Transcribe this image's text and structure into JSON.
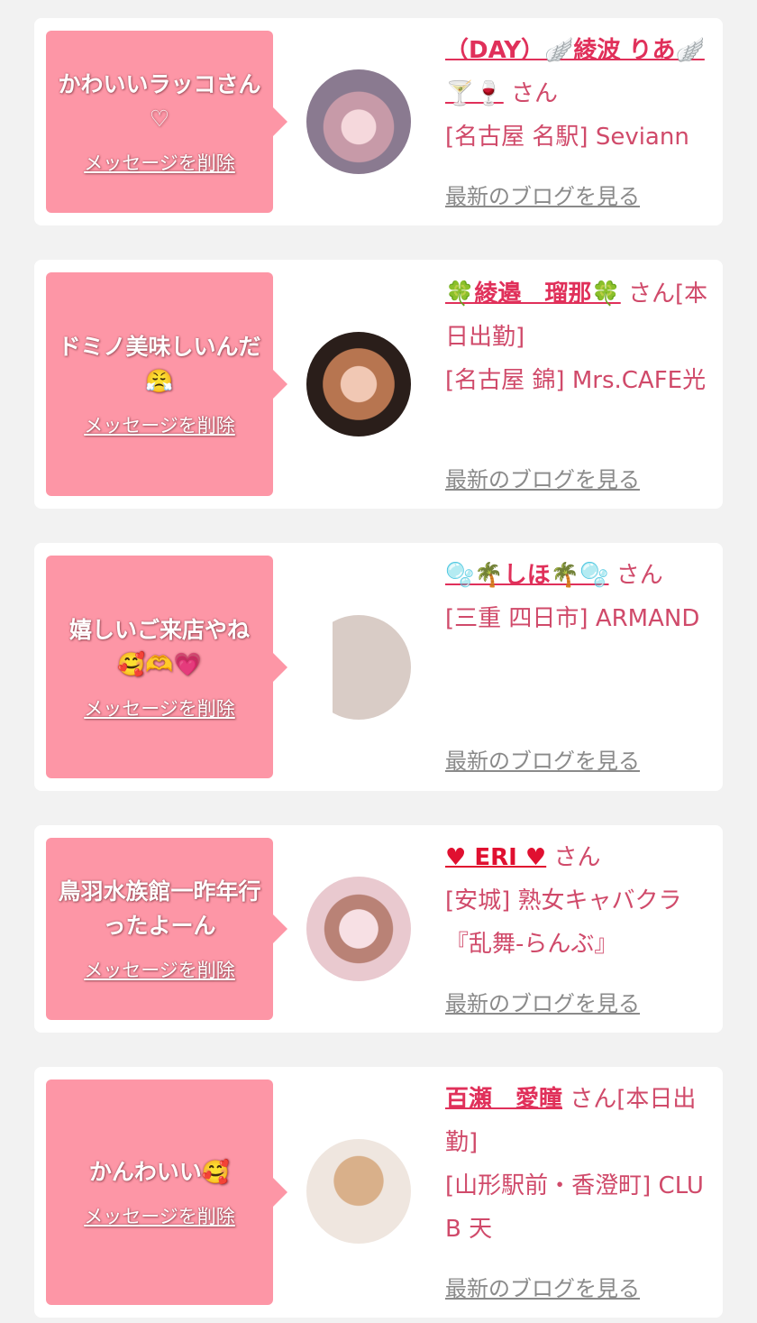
{
  "cards": [
    {
      "message": "かわいいラッコさん♡",
      "delete_label": "メッセージを削除",
      "name": "（DAY）🪽綾波 りあ🪽🍸🍷",
      "san": "さん",
      "store": "[名古屋 名駅] Seviann",
      "blog_label": "最新のブログを見る"
    },
    {
      "message": "ドミノ美味しいんだ😤",
      "delete_label": "メッセージを削除",
      "name": "🍀綾邉　瑠那🍀",
      "san": "さん[本日出勤]",
      "store": "[名古屋 錦] Mrs.CAFE光",
      "blog_label": "最新のブログを見る"
    },
    {
      "message": "嬉しいご来店やね🥰🫶💗",
      "delete_label": "メッセージを削除",
      "name": "🫧🌴しほ🌴🫧",
      "san": "さん",
      "store": "[三重 四日市] ARMAND",
      "blog_label": "最新のブログを見る"
    },
    {
      "message": "鳥羽水族館一昨年行ったよーん",
      "delete_label": "メッセージを削除",
      "name": "♥ ERI ♥",
      "san": "さん",
      "store": "[安城] 熟女キャバクラ『乱舞-らんぶ』",
      "blog_label": "最新のブログを見る"
    },
    {
      "message": "かんわいい🥰",
      "delete_label": "メッセージを削除",
      "name": "百瀬　愛瞳",
      "san": "さん[本日出勤]",
      "store": "[山形駅前・香澄町] CLUB 天",
      "blog_label": "最新のブログを見る"
    }
  ]
}
